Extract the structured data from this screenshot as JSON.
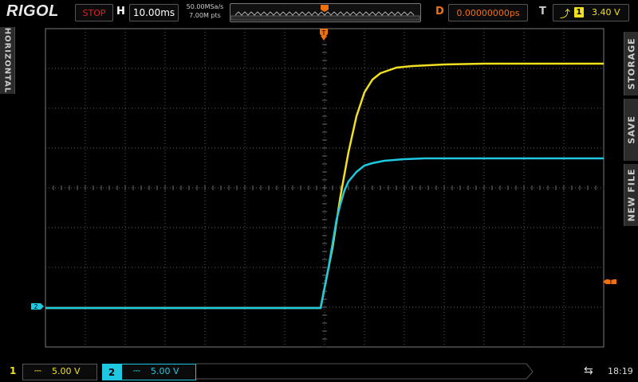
{
  "header": {
    "brand": "RIGOL",
    "run_state": "STOP",
    "horizontal_label": "H",
    "timebase": "10.00ms",
    "sample_rate": "50.00MSa/s",
    "memory_depth": "7.00M pts",
    "delay_label": "D",
    "delay_value": "0.00000000ps",
    "trigger_label": "T",
    "trigger_source": "1",
    "trigger_level": "3.40 V"
  },
  "side_menu": {
    "left_tab": "HORIZONTAL",
    "right_tabs": [
      "STORAGE",
      "SAVE",
      "NEW FILE"
    ]
  },
  "markers": {
    "trigger_position": "T",
    "trigger_level_marker": "T",
    "ch2_offset_marker": "2"
  },
  "footer": {
    "ch1": {
      "number": "1",
      "coupling": "⎓",
      "scale": "5.00 V"
    },
    "ch2": {
      "number": "2",
      "coupling": "⎓",
      "scale": "5.00 V"
    },
    "time": "18:19"
  },
  "colors": {
    "ch1": "#f0e020",
    "ch2": "#1ec8e0",
    "trigger": "#f07010",
    "stop": "#e02020"
  },
  "chart_data": {
    "type": "line",
    "xlabel": "",
    "ylabel": "",
    "xlim": [
      -70,
      70
    ],
    "ylim": [
      -20,
      20
    ],
    "grid": true,
    "x_unit": "ms",
    "y_unit": "V",
    "series": [
      {
        "channel": "1",
        "x": [
          -70,
          -1,
          2,
          4,
          6,
          8,
          10,
          12,
          14,
          18,
          22,
          30,
          40,
          70
        ],
        "y": [
          -15.1,
          -15.1,
          -7.5,
          -1.0,
          4.5,
          9.0,
          12.0,
          13.6,
          14.4,
          15.1,
          15.3,
          15.5,
          15.6,
          15.6
        ]
      },
      {
        "channel": "2",
        "x": [
          -70,
          -1,
          0,
          1,
          2,
          3,
          4,
          5,
          6,
          8,
          10,
          12,
          15,
          20,
          25,
          70
        ],
        "y": [
          -15.1,
          -15.1,
          -12.5,
          -10.0,
          -7.0,
          -4.0,
          -2.0,
          -0.3,
          0.8,
          2.0,
          2.8,
          3.1,
          3.4,
          3.6,
          3.7,
          3.7
        ]
      }
    ]
  }
}
